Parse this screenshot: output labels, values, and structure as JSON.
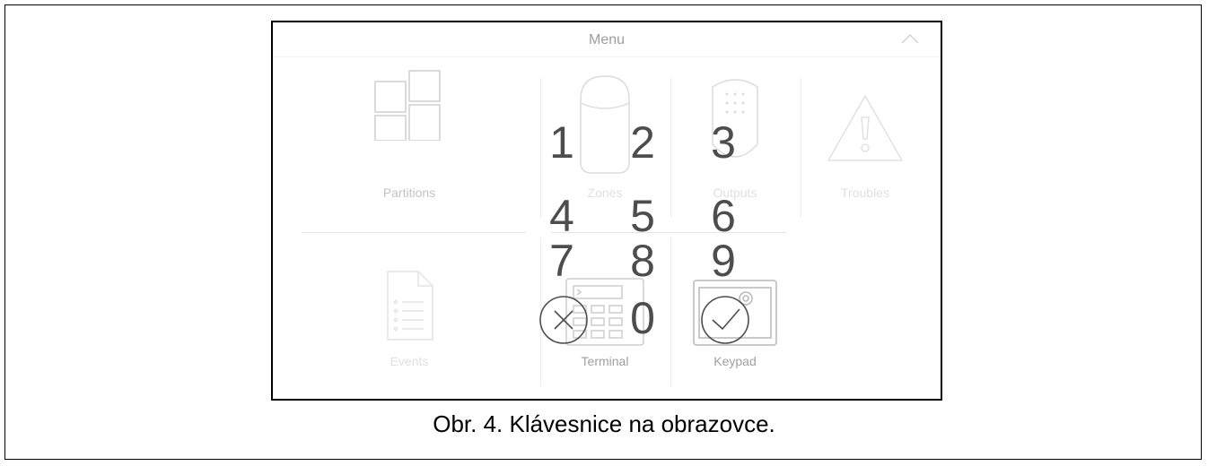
{
  "screen": {
    "title": "Menu",
    "tiles": [
      {
        "label": "Partitions",
        "icon": "partitions-icon"
      },
      {
        "label": "Zones",
        "icon": "zones-icon"
      },
      {
        "label": "Outputs",
        "icon": "outputs-icon"
      },
      {
        "label": "Troubles",
        "icon": "troubles-icon"
      },
      {
        "label": "Events",
        "icon": "events-icon"
      },
      {
        "label": "Terminal",
        "icon": "terminal-icon"
      },
      {
        "label": "Keypad",
        "icon": "keypad-icon"
      }
    ]
  },
  "keypad": {
    "keys": [
      "1",
      "2",
      "3",
      "4",
      "5",
      "6",
      "7",
      "8",
      "9",
      "0"
    ],
    "cancel_icon": "cancel-circle-x-icon",
    "confirm_icon": "confirm-circle-check-icon"
  },
  "caption": "Obr. 4. Klávesnice na obrazovce."
}
